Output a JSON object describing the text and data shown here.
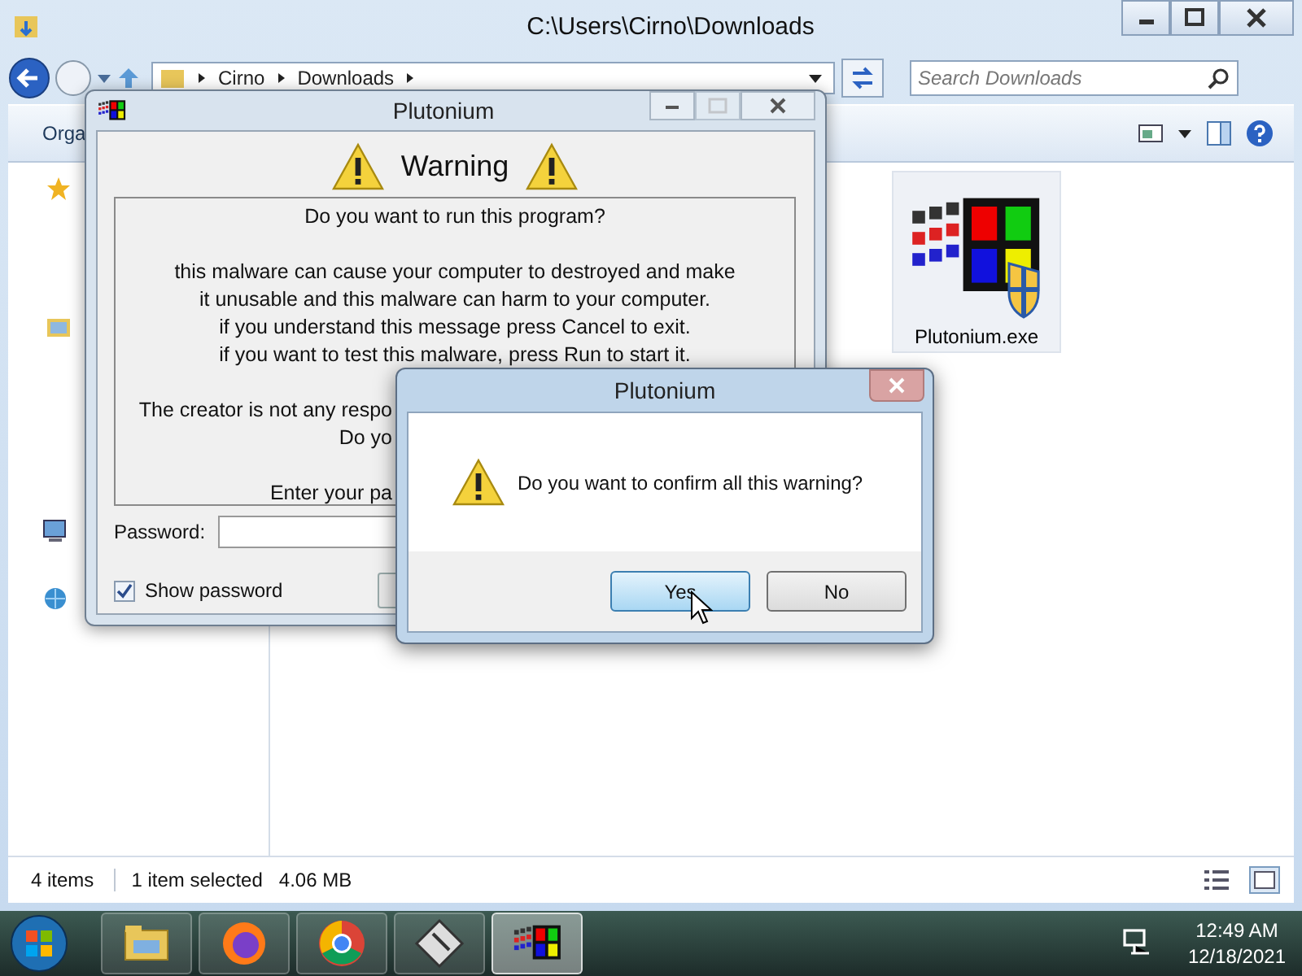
{
  "explorer": {
    "title": "C:\\Users\\Cirno\\Downloads",
    "breadcrumb": [
      "Cirno",
      "Downloads"
    ],
    "search": {
      "placeholder": "Search Downloads"
    },
    "toolbar": {
      "organize": "Orga"
    },
    "files": [
      {
        "name": "Plutonium.exe",
        "selected": true
      }
    ],
    "status_bar": {
      "count": "4 items",
      "selection": "1 item selected",
      "size": "4.06 MB"
    }
  },
  "program_window": {
    "title": "Plutonium",
    "heading": "Warning",
    "paragraphs": [
      {
        "kind": "full",
        "lines": [
          "Do you want to run this program?"
        ]
      },
      {
        "kind": "full",
        "lines": [
          "this malware can cause your computer to destroyed and make",
          "it unusable and this malware can harm to your computer.",
          "if you understand this message press Cancel to exit.",
          "if you want to test this malware, press Run to start it."
        ]
      },
      {
        "kind": "cut",
        "lines": [
          "The creator is not any respo",
          "Do yo"
        ]
      },
      {
        "kind": "cut",
        "lines": [
          "Enter your pa"
        ]
      }
    ],
    "password_label": "Password:",
    "show_password": {
      "label": "Show password",
      "checked": true
    }
  },
  "confirm_dialog": {
    "title": "Plutonium",
    "message": "Do you want to confirm all this warning?",
    "buttons": [
      {
        "label": "Yes",
        "selected": true
      },
      {
        "label": "No",
        "selected": false
      }
    ]
  },
  "taskbar": {
    "apps": [
      {
        "kind": "explorer",
        "selected": false
      },
      {
        "kind": "firefox",
        "selected": false
      },
      {
        "kind": "chrome",
        "selected": false
      },
      {
        "kind": "floppy",
        "selected": false
      },
      {
        "kind": "plutonium",
        "selected": true
      }
    ],
    "clock": {
      "time": "12:49 AM",
      "date": "12/18/2021"
    }
  }
}
